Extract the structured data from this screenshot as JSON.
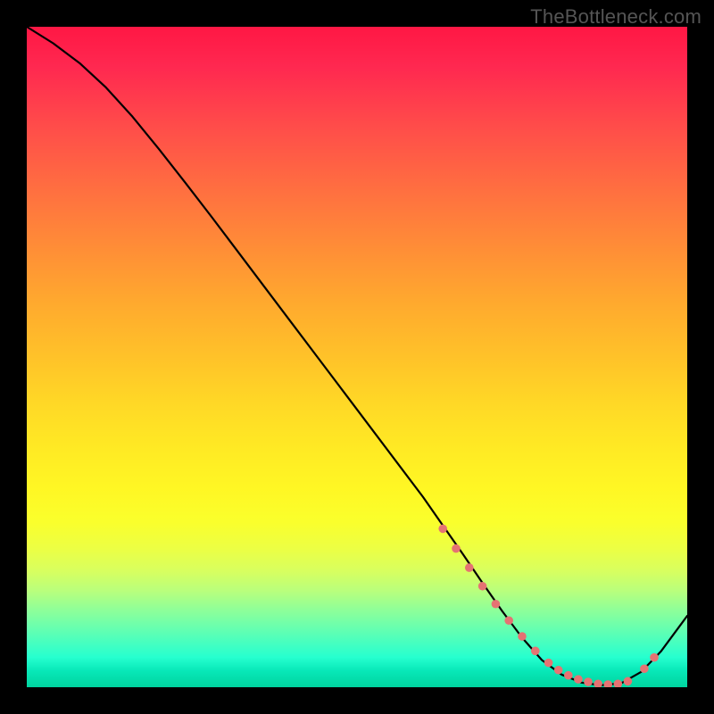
{
  "watermark": "TheBottleneck.com",
  "chart_data": {
    "type": "line",
    "title": "",
    "xlabel": "",
    "ylabel": "",
    "xlim": [
      0,
      100
    ],
    "ylim": [
      0,
      100
    ],
    "grid": false,
    "series": [
      {
        "name": "curve",
        "color": "#000000",
        "x": [
          0,
          4,
          8,
          12,
          16,
          20,
          24,
          28,
          32,
          36,
          40,
          44,
          48,
          52,
          56,
          60,
          63,
          66,
          69,
          72,
          75,
          78,
          81,
          84,
          87,
          90,
          93,
          96,
          100
        ],
        "y": [
          100,
          97.5,
          94.5,
          90.8,
          86.4,
          81.5,
          76.4,
          71.2,
          65.9,
          60.6,
          55.3,
          50.0,
          44.7,
          39.4,
          34.1,
          28.8,
          24.5,
          20.2,
          15.8,
          11.5,
          7.5,
          4.1,
          1.9,
          0.7,
          0.3,
          0.6,
          2.3,
          5.4,
          10.8
        ]
      }
    ],
    "highlighted_points": {
      "color": "#e57373",
      "x": [
        63,
        65,
        67,
        69,
        71,
        73,
        75,
        77,
        79,
        80.5,
        82,
        83.5,
        85,
        86.5,
        88,
        89.5,
        91,
        93.5,
        95
      ],
      "y": [
        24.0,
        21.0,
        18.1,
        15.3,
        12.6,
        10.1,
        7.7,
        5.5,
        3.7,
        2.6,
        1.8,
        1.2,
        0.8,
        0.5,
        0.4,
        0.5,
        0.9,
        2.8,
        4.5
      ]
    }
  }
}
